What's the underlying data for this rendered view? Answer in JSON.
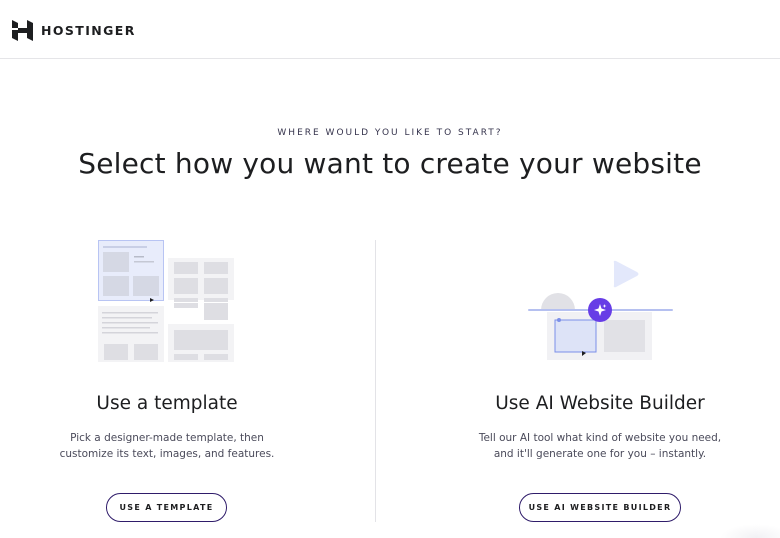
{
  "header": {
    "brand": "HOSTINGER"
  },
  "intro": {
    "eyebrow": "WHERE WOULD YOU LIKE TO START?",
    "title": "Select how you want to create your website"
  },
  "cards": [
    {
      "title": "Use a template",
      "description_line1": "Pick a designer-made template, then",
      "description_line2": "customize its text, images, and features.",
      "button_label": "USE A TEMPLATE",
      "icon": "template-grid-illustration"
    },
    {
      "title": "Use AI Website Builder",
      "description_line1": "Tell our AI tool what kind of website you need,",
      "description_line2": "and it'll generate one for you – instantly.",
      "button_label": "USE AI WEBSITE BUILDER",
      "icon": "ai-builder-illustration"
    }
  ],
  "colors": {
    "brand_dark": "#1d1e20",
    "accent_purple": "#673de6",
    "light_blue": "#e3e8fb",
    "gray_block": "#e1e1e6"
  }
}
